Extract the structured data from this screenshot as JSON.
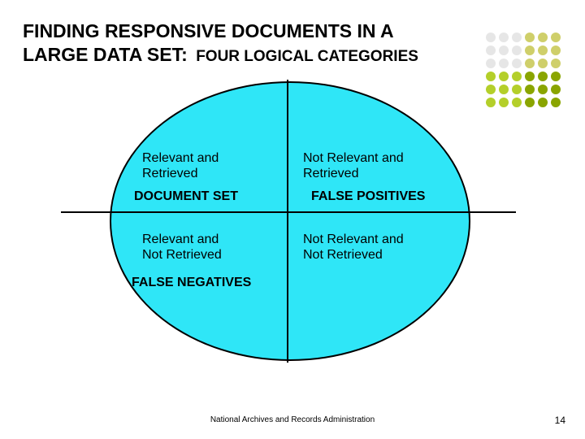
{
  "title": {
    "line1": "FINDING RESPONSIVE DOCUMENTS IN A",
    "line2_main": "LARGE DATA SET:",
    "line2_sub": "FOUR LOGICAL CATEGORIES"
  },
  "decor": {
    "dot_colors": [
      "#e6e6e6",
      "#e6e6e6",
      "#e6e6e6",
      "#cfcf6a",
      "#cfcf6a",
      "#cfcf6a",
      "#e6e6e6",
      "#e6e6e6",
      "#e6e6e6",
      "#cfcf6a",
      "#cfcf6a",
      "#cfcf6a",
      "#e6e6e6",
      "#e6e6e6",
      "#e6e6e6",
      "#cfcf6a",
      "#cfcf6a",
      "#cfcf6a",
      "#b4cf2a",
      "#b4cf2a",
      "#b4cf2a",
      "#8aa500",
      "#8aa500",
      "#8aa500",
      "#b4cf2a",
      "#b4cf2a",
      "#b4cf2a",
      "#8aa500",
      "#8aa500",
      "#8aa500",
      "#b4cf2a",
      "#b4cf2a",
      "#b4cf2a",
      "#8aa500",
      "#8aa500",
      "#8aa500"
    ]
  },
  "quadrants": {
    "tl": {
      "heading_l1": "Relevant and",
      "heading_l2": "Retrieved",
      "sub": "DOCUMENT SET"
    },
    "tr": {
      "heading_l1": "Not Relevant and",
      "heading_l2": "Retrieved",
      "sub": "FALSE POSITIVES"
    },
    "bl": {
      "heading_l1": "Relevant and",
      "heading_l2": "Not Retrieved",
      "sub": "FALSE NEGATIVES"
    },
    "br": {
      "heading_l1": "Not Relevant and",
      "heading_l2": "Not Retrieved"
    }
  },
  "ellipse": {
    "fill": "#2fe6f7"
  },
  "footer": {
    "org": "National Archives and Records Administration",
    "page": "14"
  }
}
